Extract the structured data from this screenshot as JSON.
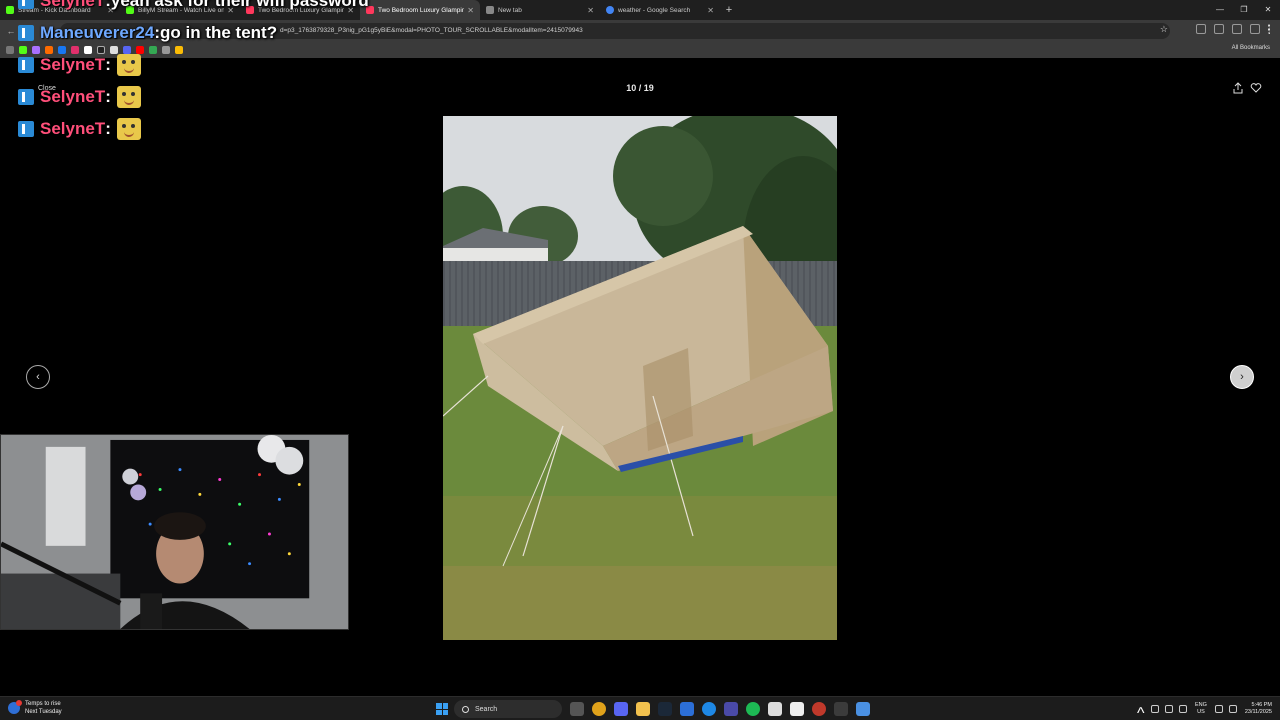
{
  "browser": {
    "tabs": [
      {
        "title": "Stream - Kick Dashboard",
        "color": "#53fc18"
      },
      {
        "title": "BillyM Stream - Watch Live on",
        "color": "#53fc18"
      },
      {
        "title": "Two Bedroom Luxury Glamping",
        "color": "#ff385c"
      },
      {
        "title": "Two Bedroom Luxury Glamping",
        "color": "#ff385c",
        "active": true
      },
      {
        "title": "New tab",
        "color": "#888888"
      },
      {
        "title": "weather - Google Search",
        "color": "#4285f4"
      }
    ],
    "new_tab_symbol": "+",
    "url": "d=p3_1763879328_P3nig_pG1g5yBiE&modal=PHOTO_TOUR_SCROLLABLE&modalItem=2415079943",
    "all_bookmarks": "All Bookmarks"
  },
  "page": {
    "counter": "10 / 19",
    "close_label": "Close",
    "prev_symbol": "‹",
    "next_symbol": "›"
  },
  "chat": [
    {
      "user": "SelyneT",
      "sep": " : ",
      "message": "yeah ask for their wifi password",
      "color": "#ff4f7a",
      "emote": false
    },
    {
      "user": "Maneuverer24",
      "sep": " : ",
      "message": "go in the tent?",
      "color": "#6ea8ff",
      "emote": false
    },
    {
      "user": "SelyneT",
      "sep": " : ",
      "message": "",
      "color": "#ff4f7a",
      "emote": true
    },
    {
      "user": "SelyneT",
      "sep": " : ",
      "message": "",
      "color": "#ff4f7a",
      "emote": true
    },
    {
      "user": "SelyneT",
      "sep": " : ",
      "message": "",
      "color": "#ff4f7a",
      "emote": true
    }
  ],
  "taskbar": {
    "weather_line1": "Temps to rise",
    "weather_line2": "Next Tuesday",
    "search_label": "Search",
    "lang_line1": "ENG",
    "lang_line2": "US",
    "time": "5:46 PM",
    "date": "23/11/2025"
  },
  "icons": {
    "share": "share-icon",
    "favorite": "heart-icon",
    "weather": "weather-icon",
    "start": "windows-start-icon"
  }
}
